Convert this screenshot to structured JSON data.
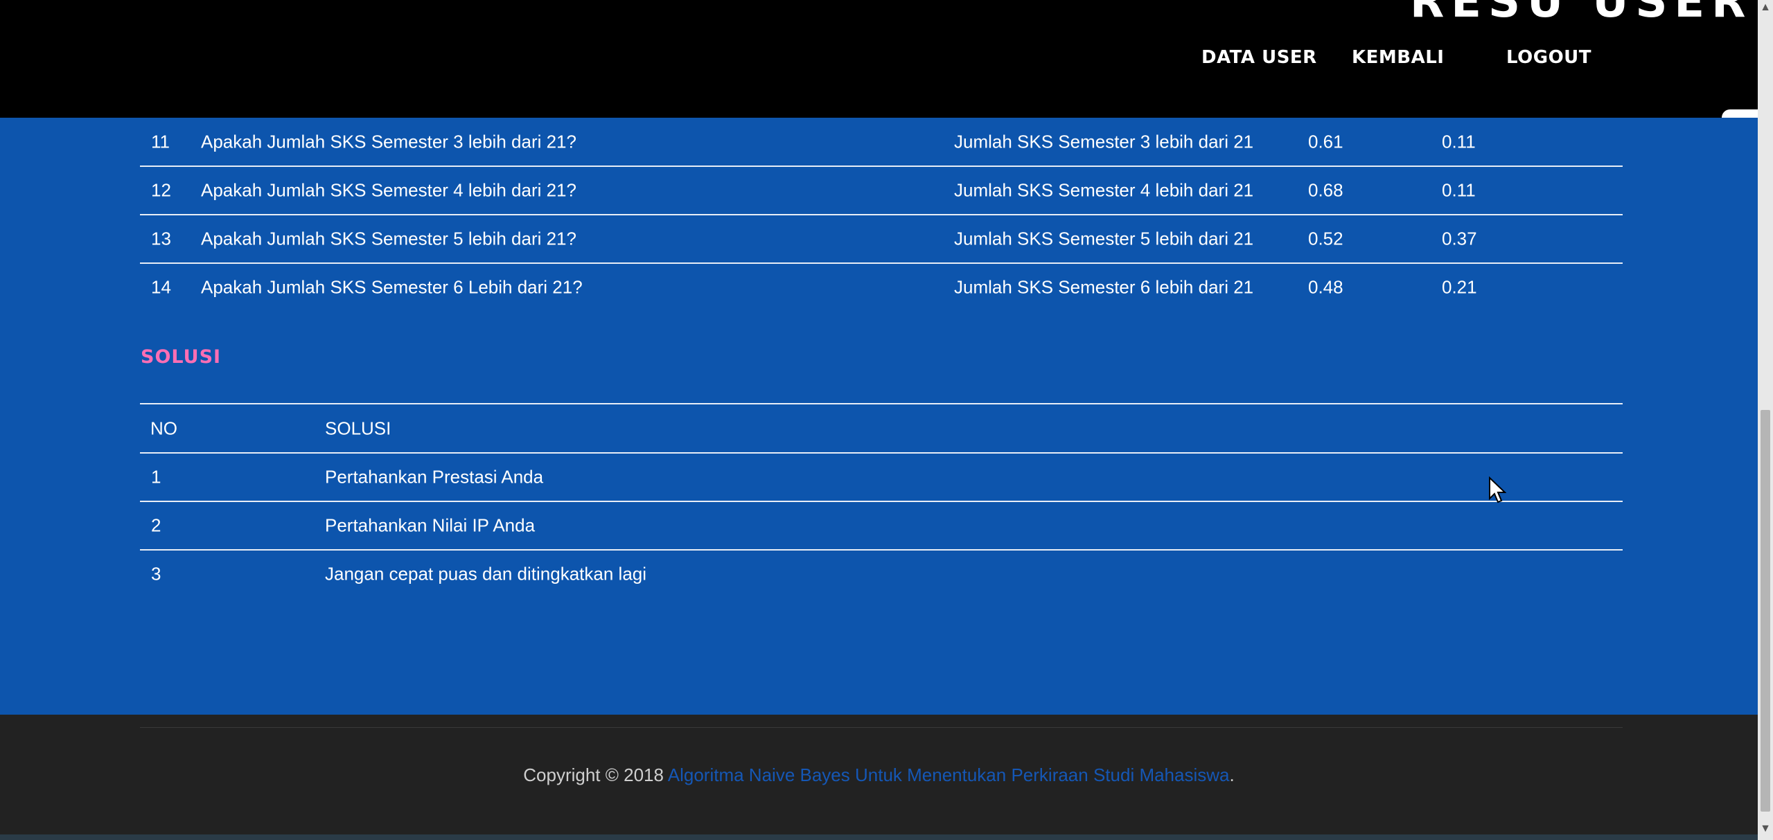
{
  "navbar": {
    "brand_fragment": "RESU  USER",
    "links": [
      "DATA USER",
      "KEMBALI",
      "LOGOUT"
    ]
  },
  "questions": [
    {
      "no": "11",
      "question": "Apakah Jumlah SKS Semester 3 lebih dari 21?",
      "gejala": "Jumlah SKS Semester 3 lebih dari 21",
      "val1": "0.61",
      "val2": "0.11"
    },
    {
      "no": "12",
      "question": "Apakah Jumlah SKS Semester 4 lebih dari 21?",
      "gejala": "Jumlah SKS Semester 4 lebih dari 21",
      "val1": "0.68",
      "val2": "0.11"
    },
    {
      "no": "13",
      "question": "Apakah Jumlah SKS Semester 5 lebih dari 21?",
      "gejala": "Jumlah SKS Semester 5 lebih dari 21",
      "val1": "0.52",
      "val2": "0.37"
    },
    {
      "no": "14",
      "question": "Apakah Jumlah SKS Semester 6 Lebih dari 21?",
      "gejala": "Jumlah SKS Semester 6 lebih dari 21",
      "val1": "0.48",
      "val2": "0.21"
    }
  ],
  "solusi": {
    "title": "SOLUSI",
    "headers": {
      "no": "NO",
      "solusi": "SOLUSI"
    },
    "rows": [
      {
        "no": "1",
        "text": "Pertahankan Prestasi Anda"
      },
      {
        "no": "2",
        "text": "Pertahankan Nilai IP Anda"
      },
      {
        "no": "3",
        "text": "Jangan cepat puas dan ditingkatkan lagi"
      }
    ]
  },
  "footer": {
    "copyright": "Copyright © 2018 ",
    "link_text": "Algoritma Naive Bayes Untuk Menentukan Perkiraan Studi Mahasiswa",
    "end": "."
  },
  "colors": {
    "page_bg": "#0d55ad",
    "navbar_bg": "#000000",
    "section_title": "#ff6eb4",
    "footer_bg": "#222222",
    "footer_link": "#1557b5"
  }
}
